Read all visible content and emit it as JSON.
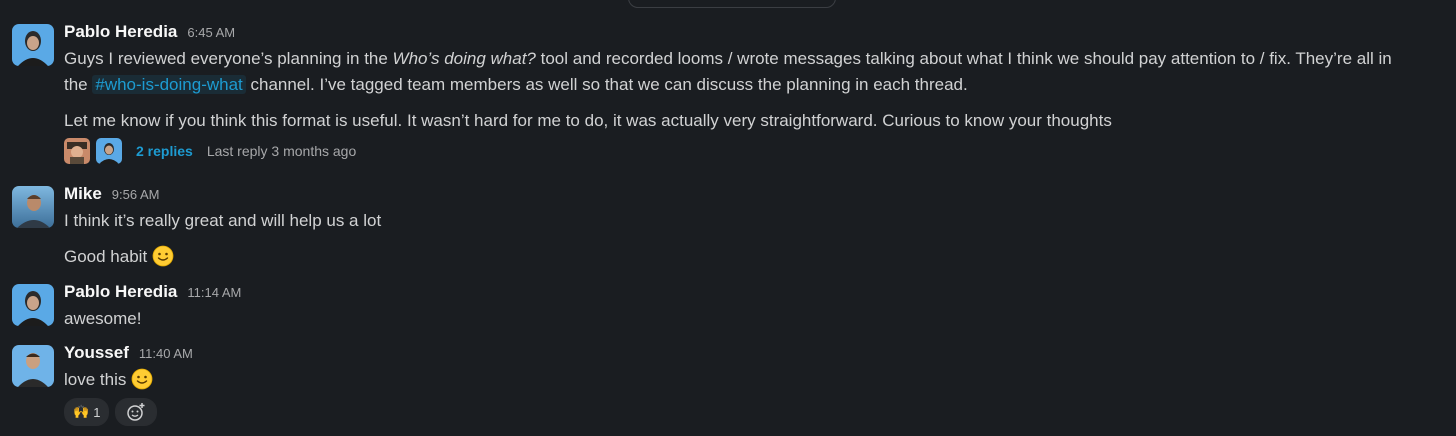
{
  "messages": [
    {
      "author": "Pablo Heredia",
      "time": "6:45 AM",
      "line1_a": "Guys I reviewed everyone’s planning in the ",
      "line1_italic": "Who’s doing what?",
      "line1_b": " tool and recorded looms / wrote messages talking about what I think we should pay attention to / fix. They’re all in",
      "line2_a": "the ",
      "channel": "#who-is-doing-what",
      "line2_b": " channel. I’ve tagged team members as well so that we can discuss the planning in each thread.",
      "para2": "Let me know if you think this format is useful. It wasn’t hard for me to do, it was actually very straightforward. Curious to know your thoughts",
      "thread": {
        "replies": "2 replies",
        "last_reply": "Last reply 3 months ago"
      }
    },
    {
      "author": "Mike",
      "time": "9:56 AM",
      "text1": "I think it’s really great and will help us a lot",
      "text2": "Good habit"
    },
    {
      "author": "Pablo Heredia",
      "time": "11:14 AM",
      "text": "awesome!"
    },
    {
      "author": "Youssef",
      "time": "11:40 AM",
      "text": "love this",
      "reactions": [
        {
          "emoji": "🙌",
          "count": "1"
        }
      ]
    }
  ],
  "icons": {
    "smile": "slightly-smiling-face",
    "add_reaction": "add-reaction-icon"
  },
  "colors": {
    "background": "#1a1d21",
    "link": "#1d9bd1",
    "text": "#d1d2d3"
  }
}
